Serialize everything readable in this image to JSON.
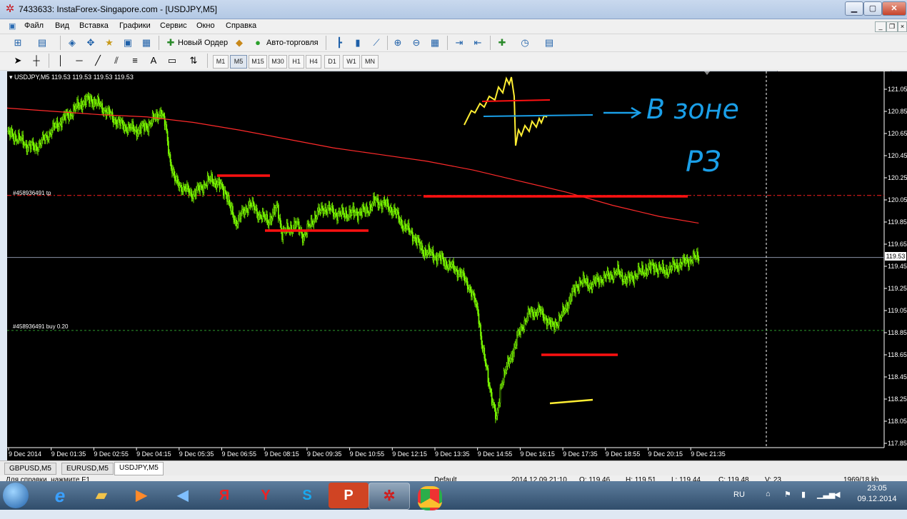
{
  "window": {
    "title": "7433633: InstaForex-Singapore.com - [USDJPY,M5]"
  },
  "menu": [
    "Файл",
    "Вид",
    "Вставка",
    "Графики",
    "Сервис",
    "Окно",
    "Справка"
  ],
  "toolbar": {
    "new_order": "Новый Ордер",
    "autotrading": "Авто-торговля"
  },
  "timeframes": [
    "M1",
    "M5",
    "M15",
    "M30",
    "H1",
    "H4",
    "D1",
    "W1",
    "MN"
  ],
  "active_timeframe": "M5",
  "chart": {
    "header": "USDJPY,M5  119.53 119.53 119.53 119.53",
    "tp_label": "#458936491 tp",
    "buy_label": "#458936491 buy 0.20",
    "current_price": "119.53",
    "y_ticks": [
      "121.05",
      "120.85",
      "120.65",
      "120.45",
      "120.25",
      "120.05",
      "119.85",
      "119.65",
      "119.45",
      "119.25",
      "119.05",
      "118.85",
      "118.65",
      "118.45",
      "118.25",
      "118.05",
      "117.85"
    ],
    "x_ticks": [
      "9 Dec 2014",
      "9 Dec 01:35",
      "9 Dec 02:55",
      "9 Dec 04:15",
      "9 Dec 05:35",
      "9 Dec 06:55",
      "9 Dec 08:15",
      "9 Dec 09:35",
      "9 Dec 10:55",
      "9 Dec 12:15",
      "9 Dec 13:35",
      "9 Dec 14:55",
      "9 Dec 16:15",
      "9 Dec 17:35",
      "9 Dec 18:55",
      "9 Dec 20:15",
      "9 Dec 21:35"
    ],
    "handwritten_annotation": "В зоне РЗ"
  },
  "chart_data": {
    "type": "candlestick",
    "symbol": "USDJPY",
    "timeframe": "M5",
    "ylim": [
      117.75,
      121.15
    ],
    "close_path": [
      [
        0,
        120.65
      ],
      [
        10,
        120.62
      ],
      [
        20,
        120.55
      ],
      [
        30,
        120.52
      ],
      [
        40,
        120.6
      ],
      [
        50,
        120.7
      ],
      [
        60,
        120.78
      ],
      [
        70,
        120.85
      ],
      [
        80,
        120.93
      ],
      [
        90,
        120.96
      ],
      [
        100,
        120.9
      ],
      [
        110,
        120.82
      ],
      [
        120,
        120.74
      ],
      [
        130,
        120.7
      ],
      [
        140,
        120.68
      ],
      [
        150,
        120.72
      ],
      [
        160,
        120.8
      ],
      [
        165,
        120.86
      ],
      [
        170,
        120.7
      ],
      [
        175,
        120.4
      ],
      [
        180,
        120.22
      ],
      [
        190,
        120.15
      ],
      [
        200,
        120.1
      ],
      [
        210,
        120.18
      ],
      [
        220,
        120.24
      ],
      [
        225,
        120.2
      ],
      [
        235,
        120.12
      ],
      [
        240,
        119.95
      ],
      [
        245,
        119.85
      ],
      [
        255,
        119.95
      ],
      [
        260,
        120.02
      ],
      [
        270,
        119.92
      ],
      [
        280,
        119.86
      ],
      [
        290,
        119.98
      ],
      [
        295,
        119.75
      ],
      [
        305,
        119.8
      ],
      [
        310,
        119.83
      ],
      [
        318,
        119.72
      ],
      [
        330,
        119.9
      ],
      [
        340,
        119.98
      ],
      [
        355,
        119.92
      ],
      [
        370,
        119.93
      ],
      [
        385,
        119.95
      ],
      [
        395,
        120.04
      ],
      [
        405,
        120.01
      ],
      [
        415,
        119.95
      ],
      [
        425,
        119.82
      ],
      [
        435,
        119.74
      ],
      [
        445,
        119.6
      ],
      [
        455,
        119.56
      ],
      [
        465,
        119.52
      ],
      [
        475,
        119.45
      ],
      [
        485,
        119.4
      ],
      [
        495,
        119.28
      ],
      [
        505,
        119.05
      ],
      [
        510,
        118.7
      ],
      [
        518,
        118.35
      ],
      [
        525,
        118.05
      ],
      [
        530,
        118.4
      ],
      [
        540,
        118.62
      ],
      [
        548,
        118.82
      ],
      [
        555,
        118.95
      ],
      [
        560,
        119.02
      ],
      [
        570,
        119.05
      ],
      [
        578,
        118.98
      ],
      [
        585,
        118.9
      ],
      [
        595,
        119.0
      ],
      [
        605,
        119.18
      ],
      [
        615,
        119.32
      ],
      [
        625,
        119.28
      ],
      [
        635,
        119.33
      ],
      [
        645,
        119.36
      ],
      [
        655,
        119.4
      ],
      [
        665,
        119.32
      ],
      [
        675,
        119.38
      ],
      [
        685,
        119.42
      ],
      [
        695,
        119.45
      ],
      [
        705,
        119.4
      ],
      [
        715,
        119.45
      ],
      [
        725,
        119.48
      ],
      [
        735,
        119.52
      ],
      [
        742,
        119.53
      ]
    ],
    "moving_average": [
      [
        0,
        120.88
      ],
      [
        50,
        120.85
      ],
      [
        100,
        120.82
      ],
      [
        150,
        120.8
      ],
      [
        200,
        120.75
      ],
      [
        250,
        120.68
      ],
      [
        300,
        120.6
      ],
      [
        350,
        120.52
      ],
      [
        400,
        120.46
      ],
      [
        450,
        120.4
      ],
      [
        500,
        120.32
      ],
      [
        550,
        120.22
      ],
      [
        600,
        120.12
      ],
      [
        650,
        120.0
      ],
      [
        700,
        119.9
      ],
      [
        742,
        119.84
      ]
    ],
    "levels": {
      "tp": 120.09,
      "buy": 118.87,
      "current": 119.53
    }
  },
  "tabs": [
    "GBPUSD,M5",
    "EURUSD,M5",
    "USDJPY,M5"
  ],
  "active_tab": "USDJPY,M5",
  "statusbar": {
    "help": "Для справки, нажмите F1",
    "profile": "Default",
    "datetime": "2014.12.09 21:10",
    "open": "O: 119.46",
    "high": "H: 119.51",
    "low": "L: 119.44",
    "close": "C: 119.48",
    "volume": "V: 23",
    "traffic": "1969/18 kb"
  },
  "taskbar": {
    "lang": "RU",
    "time": "23:05",
    "date": "09.12.2014"
  },
  "colors": {
    "candle": "#7CFC00",
    "ma": "#ff2a2a",
    "annotation_red": "#ff1111",
    "annotation_blue": "#1a9fe8",
    "annotation_yellow": "#ffee33"
  }
}
